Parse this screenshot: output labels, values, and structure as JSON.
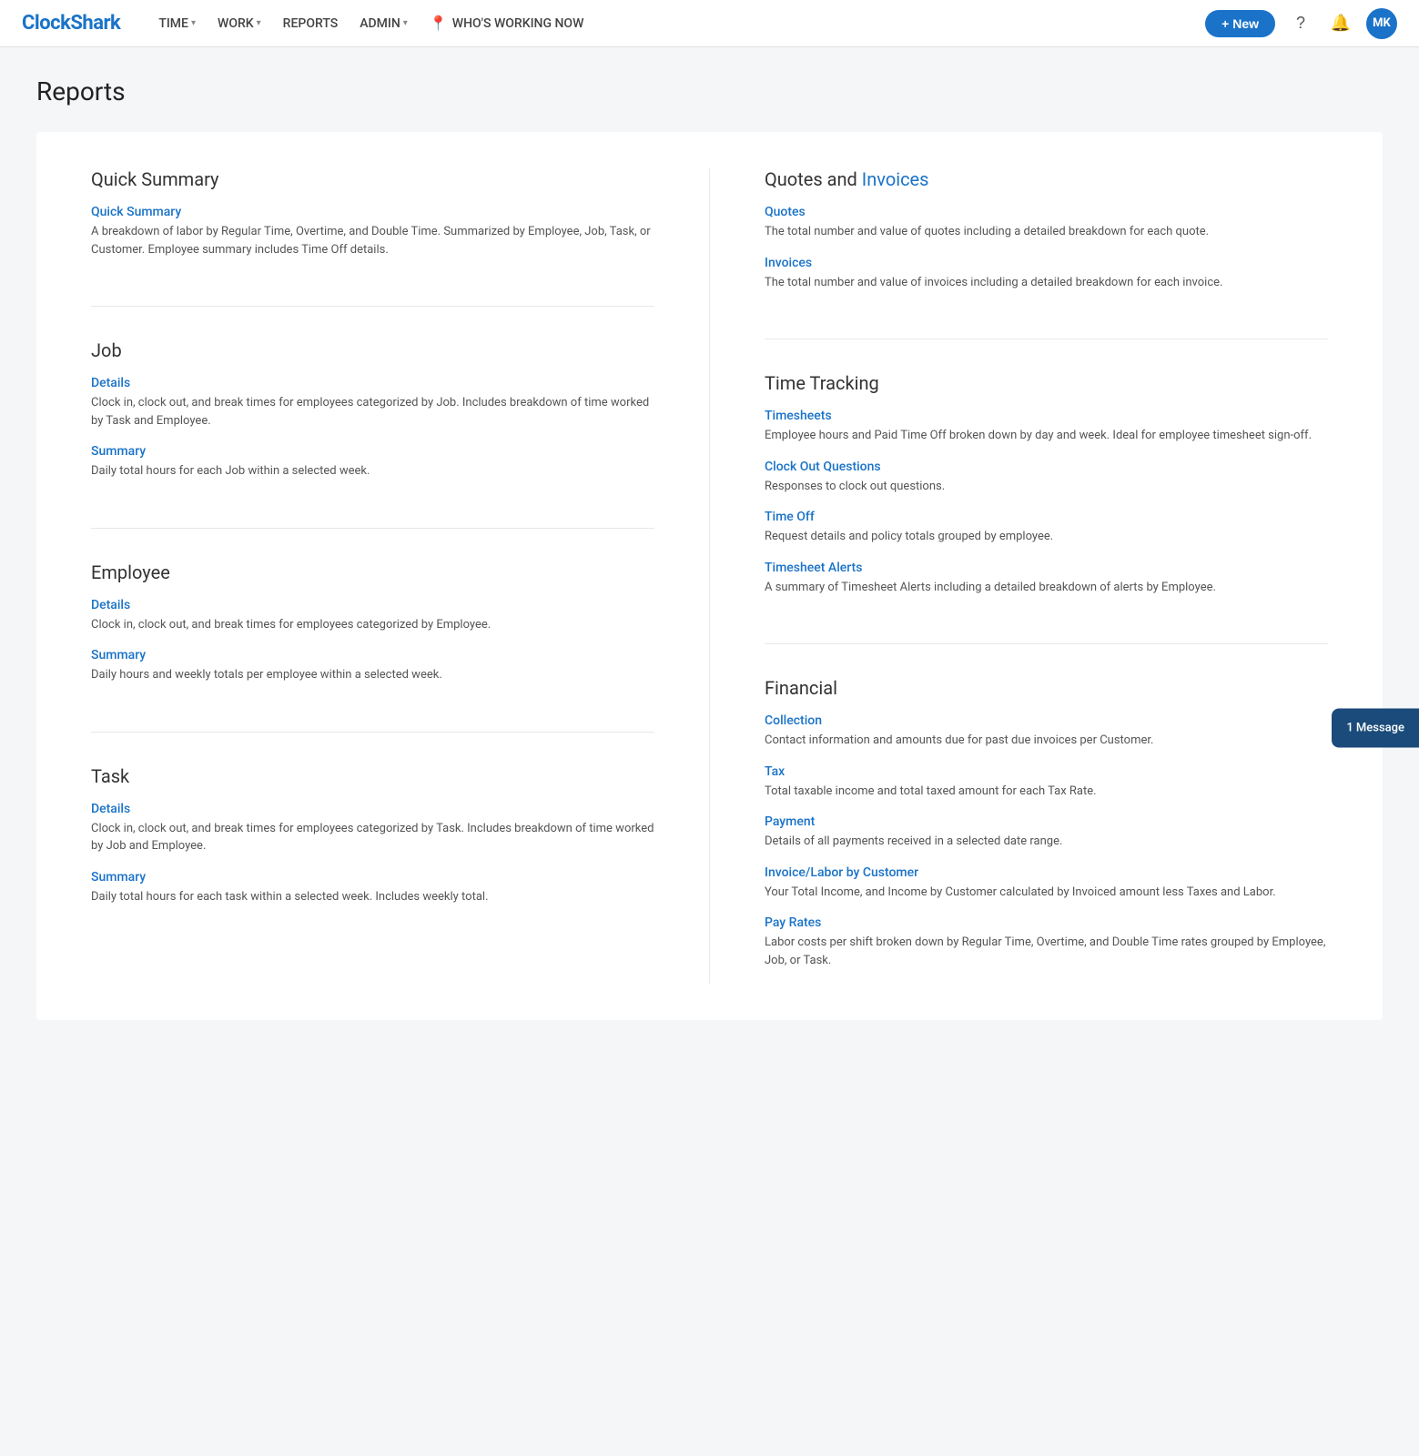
{
  "brand": {
    "name": "ClockShark",
    "logo_text": "ClockShark"
  },
  "nav": {
    "links": [
      {
        "label": "TIME",
        "has_dropdown": true
      },
      {
        "label": "WORK",
        "has_dropdown": true
      },
      {
        "label": "REPORTS",
        "has_dropdown": false
      },
      {
        "label": "ADMIN",
        "has_dropdown": true
      },
      {
        "label": "WHO'S WORKING NOW",
        "has_pin": true
      }
    ],
    "new_button": "+ New",
    "avatar_initials": "MK"
  },
  "page": {
    "title": "Reports"
  },
  "left_column": {
    "sections": [
      {
        "id": "quick-summary",
        "title": "Quick Summary",
        "items": [
          {
            "link": "Quick Summary",
            "desc": "A breakdown of labor by Regular Time, Overtime, and Double Time. Summarized by Employee, Job, Task, or Customer. Employee summary includes Time Off details."
          }
        ]
      },
      {
        "id": "job",
        "title": "Job",
        "items": [
          {
            "link": "Details",
            "desc": "Clock in, clock out, and break times for employees categorized by Job. Includes breakdown of time worked by Task and Employee."
          },
          {
            "link": "Summary",
            "desc": "Daily total hours for each Job within a selected week."
          }
        ]
      },
      {
        "id": "employee",
        "title": "Employee",
        "items": [
          {
            "link": "Details",
            "desc": "Clock in, clock out, and break times for employees categorized by Employee."
          },
          {
            "link": "Summary",
            "desc": "Daily hours and weekly totals per employee within a selected week."
          }
        ]
      },
      {
        "id": "task",
        "title": "Task",
        "items": [
          {
            "link": "Details",
            "desc": "Clock in, clock out, and break times for employees categorized by Task. Includes breakdown of time worked by Job and Employee."
          },
          {
            "link": "Summary",
            "desc": "Daily total hours for each task within a selected week. Includes weekly total."
          }
        ]
      }
    ]
  },
  "right_column": {
    "sections": [
      {
        "id": "quotes-invoices",
        "title_plain": "Quotes and ",
        "title_highlight": "Invoices",
        "items": [
          {
            "link": "Quotes",
            "desc": "The total number and value of quotes including a detailed breakdown for each quote."
          },
          {
            "link": "Invoices",
            "desc": "The total number and value of invoices including a detailed breakdown for each invoice."
          }
        ]
      },
      {
        "id": "time-tracking",
        "title": "Time Tracking",
        "items": [
          {
            "link": "Timesheets",
            "desc": "Employee hours and Paid Time Off broken down by day and week. Ideal for employee timesheet sign-off."
          },
          {
            "link": "Clock Out Questions",
            "desc": "Responses to clock out questions."
          },
          {
            "link": "Time Off",
            "desc": "Request details and policy totals grouped by employee."
          },
          {
            "link": "Timesheet Alerts",
            "desc": "A summary of Timesheet Alerts including a detailed breakdown of alerts by Employee."
          }
        ]
      },
      {
        "id": "financial",
        "title": "Financial",
        "items": [
          {
            "link": "Collection",
            "desc": "Contact information and amounts due for past due invoices per Customer."
          },
          {
            "link": "Tax",
            "desc": "Total taxable income and total taxed amount for each Tax Rate."
          },
          {
            "link": "Payment",
            "desc": "Details of all payments received in a selected date range."
          },
          {
            "link": "Invoice/Labor by Customer",
            "desc": "Your Total Income, and Income by Customer calculated by Invoiced amount less Taxes and Labor."
          },
          {
            "link": "Pay Rates",
            "desc": "Labor costs per shift broken down by Regular Time, Overtime, and Double Time rates grouped by Employee, Job, or Task."
          }
        ]
      }
    ]
  },
  "message_bubble": {
    "label": "1 Message"
  }
}
